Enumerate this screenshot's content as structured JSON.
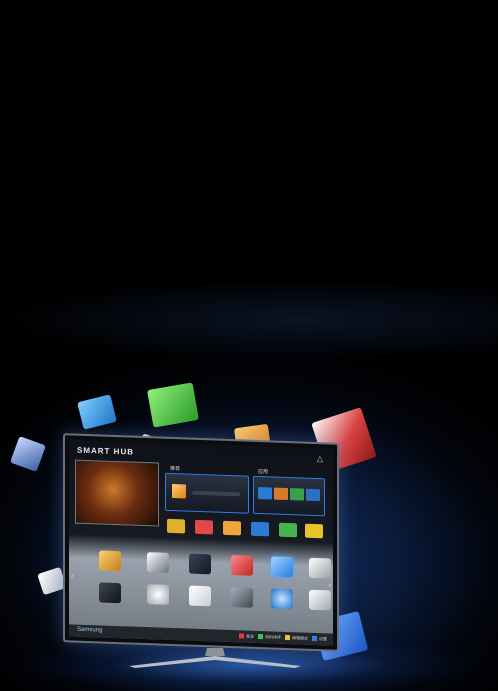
{
  "tv": {
    "hub_title": "SMART HUB",
    "wifi": "△",
    "preview_caption": "",
    "panel_a_label": "推荐",
    "panel_b_label": "应用",
    "brand": "Samsung",
    "nav_left": "‹",
    "nav_right": "›",
    "color_buttons": [
      {
        "color": "#e23b3b",
        "label": "登录"
      },
      {
        "color": "#3fbf4d",
        "label": "资料排序"
      },
      {
        "color": "#e6c42a",
        "label": "编辑模式"
      },
      {
        "color": "#3b7fe0",
        "label": "设置"
      }
    ]
  },
  "colors": {
    "accent_blue": "#2e7de0",
    "floor_glow": "#4a8cff"
  },
  "icons": [
    "smart-hub-app-icon",
    "browser-icon",
    "game-icon",
    "social-icon",
    "video-icon",
    "music-icon"
  ]
}
